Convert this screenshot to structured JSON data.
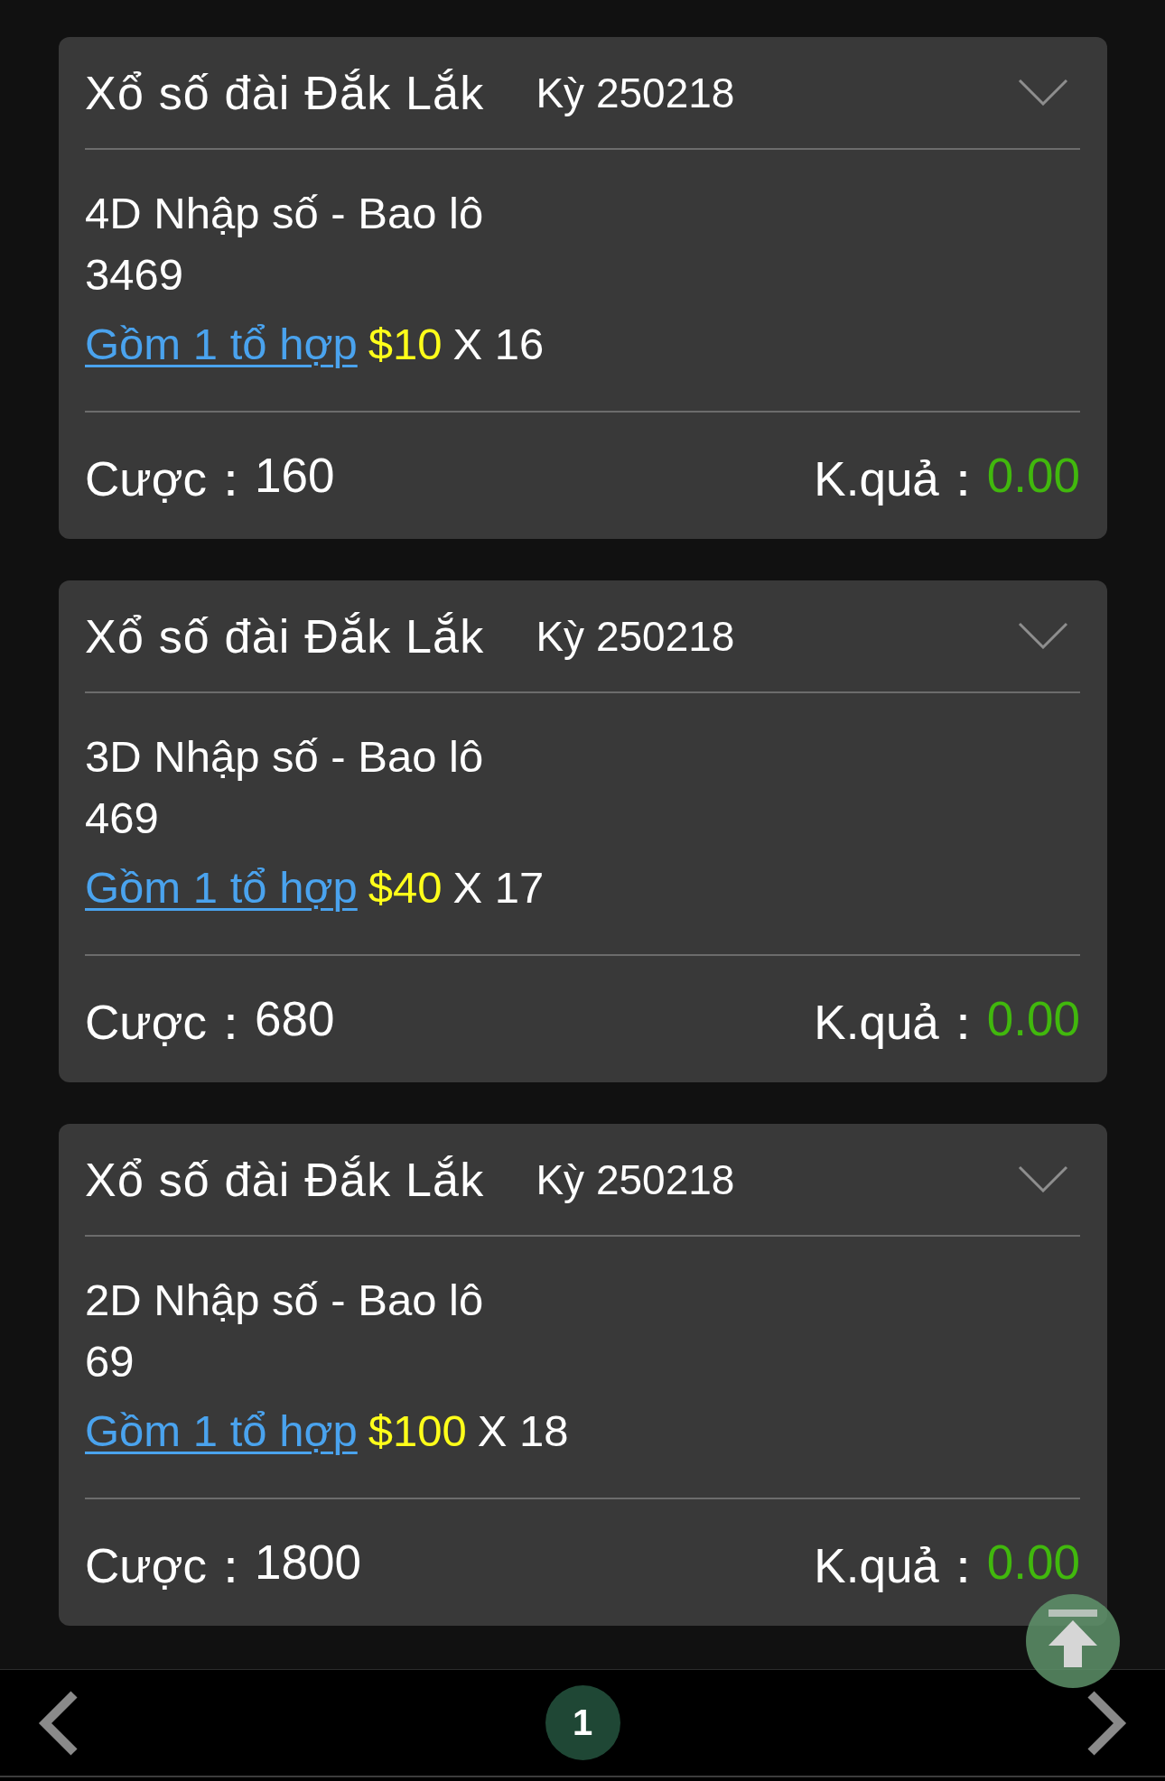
{
  "tickets": [
    {
      "lottery": "Xổ số đài Đắk Lắk",
      "draw": "Kỳ 250218",
      "bet_type": "4D Nhập số - Bao lô",
      "numbers": "3469",
      "combinations": "Gồm 1 tổ hợp",
      "unit_price": "$10",
      "multiplier": "X 16",
      "stake": {
        "label": "Cược：",
        "value": "160"
      },
      "result": {
        "label": "K.quả：",
        "value": "0.00"
      }
    },
    {
      "lottery": "Xổ số đài Đắk Lắk",
      "draw": "Kỳ 250218",
      "bet_type": "3D Nhập số - Bao lô",
      "numbers": "469",
      "combinations": "Gồm 1 tổ hợp",
      "unit_price": "$40",
      "multiplier": "X 17",
      "stake": {
        "label": "Cược：",
        "value": "680"
      },
      "result": {
        "label": "K.quả：",
        "value": "0.00"
      }
    },
    {
      "lottery": "Xổ số đài Đắk Lắk",
      "draw": "Kỳ 250218",
      "bet_type": "2D Nhập số - Bao lô",
      "numbers": "69",
      "combinations": "Gồm 1 tổ hợp",
      "unit_price": "$100",
      "multiplier": "X 18",
      "stake": {
        "label": "Cược：",
        "value": "1800"
      },
      "result": {
        "label": "K.quả：",
        "value": "0.00"
      }
    }
  ],
  "pagination": {
    "pages": [
      {
        "label": "1",
        "selected": true
      }
    ]
  }
}
